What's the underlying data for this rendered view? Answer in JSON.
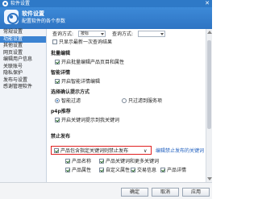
{
  "window": {
    "title": "软件设置",
    "close_glyph": "✕"
  },
  "header": {
    "title": "软件设置",
    "subtitle": "配置软件的各个参数"
  },
  "sidebar": {
    "items": [
      {
        "label": "常规设置",
        "active": false
      },
      {
        "label": "功能设置",
        "active": true
      },
      {
        "label": "其他设置",
        "active": false
      },
      {
        "label": "网页设置",
        "active": false
      },
      {
        "label": "编辑用户信息",
        "active": false
      },
      {
        "label": "关联账号",
        "active": false
      },
      {
        "label": "隐私保护",
        "active": false
      },
      {
        "label": "发布与设置",
        "active": false
      },
      {
        "label": "感谢管理软件",
        "active": false
      }
    ]
  },
  "content": {
    "query_row": {
      "label1": "查询方式:",
      "select1": "按标",
      "label2": "查询方式:",
      "select2": ""
    },
    "search_once": {
      "label": "只显示最新一次查询结果",
      "checked": false
    },
    "batch_edit": {
      "title": "批量编辑",
      "option": {
        "label": "开启批量编辑产品页目和属性",
        "checked": true
      }
    },
    "smart_detail": {
      "title": "智能详情",
      "option": {
        "label": "开启智能详情编辑",
        "checked": true
      }
    },
    "confirm_dialog": {
      "title": "选择确认提示方式",
      "radio1": {
        "label": "智能过滤",
        "checked": true
      },
      "radio2": {
        "label": "只过滤到服务项",
        "checked": false
      }
    },
    "p4p": {
      "title": "p4p推荐",
      "option": {
        "label": "开启关键词提示到我关键词",
        "checked": true
      }
    },
    "publish": {
      "title": "禁止发布",
      "main_option": {
        "label": "产品包含指定关键词则禁止发布",
        "checked": true,
        "chevron": "∨"
      },
      "link": "编辑禁止发布的关键词",
      "grid": [
        {
          "label": "产品名称",
          "checked": true
        },
        {
          "label": "产品关键词和更多关键词",
          "checked": true
        },
        {
          "label": "产品属性",
          "checked": true
        },
        {
          "label": "自定义属性",
          "checked": true
        },
        {
          "label": "交易信息",
          "checked": true
        },
        {
          "label": "产品详情",
          "checked": true
        }
      ]
    }
  },
  "footer": {
    "ok": "确定",
    "cancel": "取消",
    "apply": "应用"
  }
}
